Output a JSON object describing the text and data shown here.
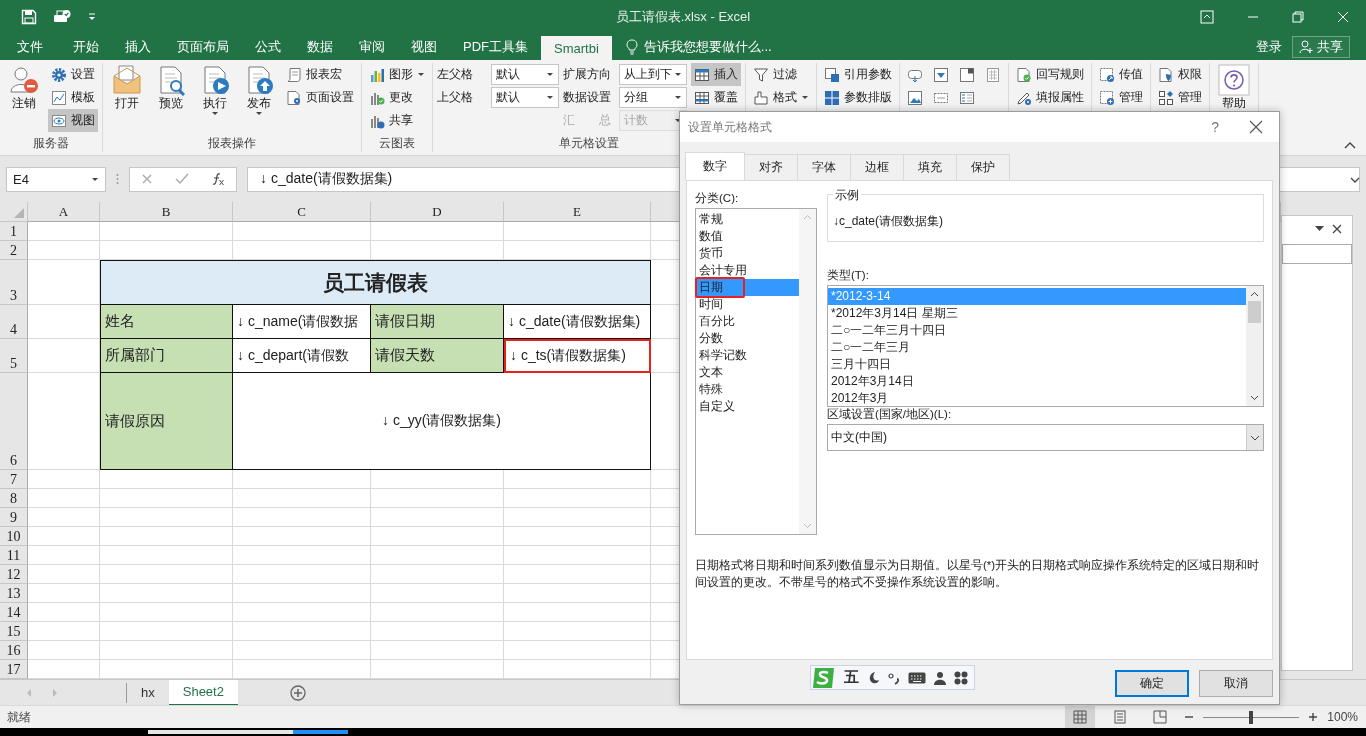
{
  "title_bar": {
    "title": "员工请假表.xlsx - Excel"
  },
  "ribbon_tabs": [
    {
      "label": "文件",
      "selected": false
    },
    {
      "label": "开始",
      "selected": false
    },
    {
      "label": "插入",
      "selected": false
    },
    {
      "label": "页面布局",
      "selected": false
    },
    {
      "label": "公式",
      "selected": false
    },
    {
      "label": "数据",
      "selected": false
    },
    {
      "label": "审阅",
      "selected": false
    },
    {
      "label": "视图",
      "selected": false
    },
    {
      "label": "PDF工具集",
      "selected": false
    },
    {
      "label": "Smartbi",
      "selected": true
    }
  ],
  "tell_me": {
    "placeholder": "告诉我您想要做什么..."
  },
  "sign_in": "登录",
  "share": "共享",
  "ribbon_groups": [
    {
      "label": "服务器",
      "columns": [
        [
          {
            "kind": "large",
            "label": "注销",
            "selected": false
          }
        ],
        [
          {
            "kind": "small",
            "label": "设置",
            "selected": false
          },
          {
            "kind": "small",
            "label": "模板",
            "selected": false
          },
          {
            "kind": "small",
            "label": "视图",
            "selected": true
          }
        ]
      ]
    },
    {
      "label": "报表操作",
      "columns": [
        [
          {
            "kind": "large",
            "label": "打开",
            "selected": false
          }
        ],
        [
          {
            "kind": "large",
            "label": "预览",
            "selected": false
          }
        ],
        [
          {
            "kind": "large-menu",
            "label": "执行",
            "selected": false
          }
        ],
        [
          {
            "kind": "large-menu",
            "label": "发布",
            "selected": false
          }
        ],
        [
          {
            "kind": "small",
            "label": "报表宏",
            "selected": false
          },
          {
            "kind": "small",
            "label": "页面设置",
            "selected": false
          }
        ]
      ]
    },
    {
      "label": "云图表",
      "columns": [
        [
          {
            "kind": "small-menu",
            "label": "图形",
            "selected": false
          },
          {
            "kind": "small",
            "label": "更改",
            "selected": false
          },
          {
            "kind": "small",
            "label": "共享",
            "selected": false
          }
        ]
      ]
    },
    {
      "label": "单元格设置",
      "columns": [
        [
          {
            "kind": "field",
            "label": "左父格",
            "value": "默认",
            "disabled": false
          },
          {
            "kind": "field",
            "label": "上父格",
            "value": "默认",
            "disabled": false
          }
        ],
        [
          {
            "kind": "field",
            "label": "扩展方向",
            "value": "从上到下",
            "disabled": false
          },
          {
            "kind": "field",
            "label": "数据设置",
            "value": "分组",
            "disabled": false
          },
          {
            "kind": "field",
            "label": "汇　　总",
            "value": "计数",
            "disabled": true
          }
        ],
        [
          {
            "kind": "small",
            "label": "插入",
            "selected": true
          },
          {
            "kind": "small",
            "label": "覆盖",
            "selected": false
          }
        ]
      ]
    },
    {
      "columns": [
        [
          {
            "kind": "small",
            "label": "过滤",
            "selected": false
          },
          {
            "kind": "small-menu",
            "label": "格式",
            "selected": false
          }
        ]
      ]
    },
    {
      "columns": [
        [
          {
            "kind": "small",
            "label": "引用参数",
            "selected": false
          },
          {
            "kind": "small",
            "label": "参数排版",
            "selected": false
          }
        ]
      ]
    },
    {
      "columns": [
        [
          {
            "kind": "icon"
          },
          {
            "kind": "icon"
          }
        ],
        [
          {
            "kind": "icon"
          },
          {
            "kind": "icon"
          }
        ],
        [
          {
            "kind": "icon"
          },
          {
            "kind": "icon"
          }
        ],
        [
          {
            "kind": "icon"
          }
        ]
      ]
    },
    {
      "columns": [
        [
          {
            "kind": "small",
            "label": "回写规则",
            "selected": false
          },
          {
            "kind": "small",
            "label": "填报属性",
            "selected": false
          }
        ]
      ]
    },
    {
      "columns": [
        [
          {
            "kind": "small",
            "label": "传值",
            "selected": false
          },
          {
            "kind": "small",
            "label": "管理",
            "selected": false
          }
        ]
      ]
    },
    {
      "columns": [
        [
          {
            "kind": "small",
            "label": "权限",
            "selected": false
          },
          {
            "kind": "small",
            "label": "管理",
            "selected": false
          }
        ]
      ]
    },
    {
      "columns": [
        [
          {
            "kind": "large",
            "label": "帮助",
            "selected": false
          }
        ]
      ]
    }
  ],
  "name_box": "E4",
  "formula": "↓ c_date(请假数据集)",
  "sheet": {
    "columns": [
      "A",
      "B",
      "C",
      "D",
      "E"
    ],
    "rows": [
      "1",
      "2",
      "3",
      "4",
      "5",
      "6",
      "7",
      "8",
      "9",
      "10",
      "11",
      "12",
      "13",
      "14",
      "15",
      "16",
      "17"
    ],
    "report_title": "员工请假表",
    "report_rows": [
      [
        {
          "kind": "label",
          "text": "姓名",
          "marked": false
        },
        {
          "kind": "value",
          "text": "↓ c_name(请假数据",
          "marked": false
        },
        {
          "kind": "label",
          "text": "请假日期",
          "marked": false
        },
        {
          "kind": "value",
          "text": "↓ c_date(请假数据集)",
          "marked": false
        }
      ],
      [
        {
          "kind": "label",
          "text": "所属部门",
          "marked": false
        },
        {
          "kind": "value",
          "text": "↓ c_depart(请假数",
          "marked": false
        },
        {
          "kind": "label",
          "text": "请假天数",
          "marked": false
        },
        {
          "kind": "value",
          "text": "↓ c_ts(请假数据集)",
          "marked": true
        }
      ],
      [
        {
          "kind": "label",
          "text": "请假原因",
          "marked": false
        },
        {
          "kind": "value",
          "text": "↓ c_yy(请假数据集)",
          "marked": false
        }
      ]
    ]
  },
  "sheet_tabs": [
    {
      "label": "hx",
      "selected": false
    },
    {
      "label": "Sheet2",
      "selected": true
    }
  ],
  "status": "就绪",
  "view_buttons": [
    {
      "selected": true
    },
    {
      "selected": false
    },
    {
      "selected": false
    }
  ],
  "zoom": {
    "level": 0.5,
    "reading": "100%"
  },
  "dialog": {
    "title": "设置单元格格式",
    "help": "?",
    "tabs": [
      {
        "label": "数字",
        "selected": true
      },
      {
        "label": "对齐",
        "selected": false
      },
      {
        "label": "字体",
        "selected": false
      },
      {
        "label": "边框",
        "selected": false
      },
      {
        "label": "填充",
        "selected": false
      },
      {
        "label": "保护",
        "selected": false
      }
    ],
    "category_label": "分类(C):",
    "categories": [
      {
        "label": "常规",
        "selected": false,
        "marked": false
      },
      {
        "label": "数值",
        "selected": false,
        "marked": false
      },
      {
        "label": "货币",
        "selected": false,
        "marked": false
      },
      {
        "label": "会计专用",
        "selected": false,
        "marked": false
      },
      {
        "label": "日期",
        "selected": true,
        "marked": true
      },
      {
        "label": "时间",
        "selected": false,
        "marked": false
      },
      {
        "label": "百分比",
        "selected": false,
        "marked": false
      },
      {
        "label": "分数",
        "selected": false,
        "marked": false
      },
      {
        "label": "科学记数",
        "selected": false,
        "marked": false
      },
      {
        "label": "文本",
        "selected": false,
        "marked": false
      },
      {
        "label": "特殊",
        "selected": false,
        "marked": false
      },
      {
        "label": "自定义",
        "selected": false,
        "marked": false
      }
    ],
    "sample_label": "示例",
    "sample": "↓c_date(请假数据集)",
    "type_label": "类型(T):",
    "types": [
      {
        "label": "*2012-3-14",
        "selected": true
      },
      {
        "label": "*2012年3月14日 星期三",
        "selected": false
      },
      {
        "label": "二○一二年三月十四日",
        "selected": false
      },
      {
        "label": "二○一二年三月",
        "selected": false
      },
      {
        "label": "三月十四日",
        "selected": false
      },
      {
        "label": "2012年3月14日",
        "selected": false
      },
      {
        "label": "2012年3月",
        "selected": false
      }
    ],
    "locale_label": "区域设置(国家/地区)(L):",
    "locale": "中文(中国)",
    "description": "日期格式将日期和时间系列数值显示为日期值。以星号(*)开头的日期格式响应操作系统特定的区域日期和时间设置的更改。不带星号的格式不受操作系统设置的影响。",
    "buttons": [
      {
        "label": "确定",
        "default": true
      },
      {
        "label": "取消",
        "default": false
      }
    ]
  },
  "ime": {
    "mode": "五"
  }
}
